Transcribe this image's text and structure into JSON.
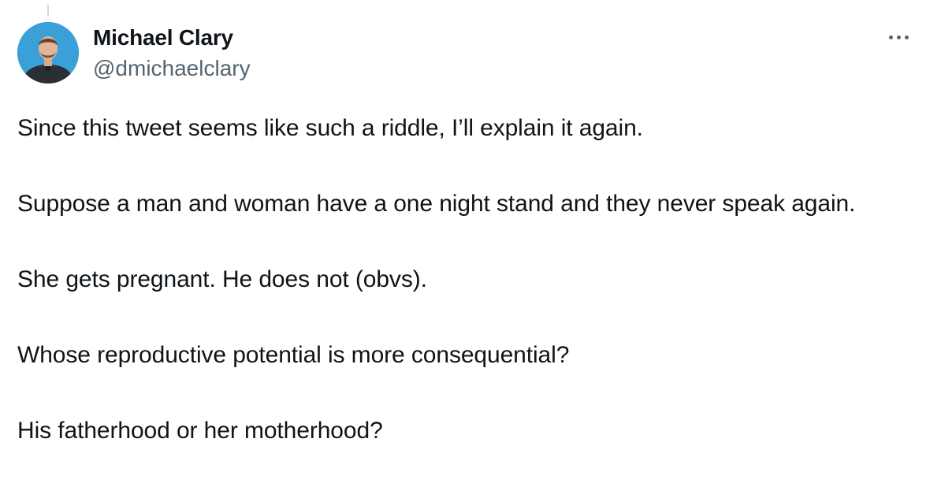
{
  "tweet": {
    "author": {
      "display_name": "Michael Clary",
      "handle": "@dmichaelclary"
    },
    "paragraphs": [
      "Since this tweet seems like such a riddle, I’ll explain it again.",
      "Suppose a man and woman have a one night stand and they never speak again.",
      "She gets pregnant. He does not (obvs).",
      "Whose reproductive potential is more consequential?",
      "His fatherhood or her motherhood?"
    ]
  },
  "icons": {
    "more": "more-options-icon"
  },
  "colors": {
    "text": "#0f1419",
    "secondary_text": "#536471",
    "avatar_background": "#3aa0d8"
  }
}
